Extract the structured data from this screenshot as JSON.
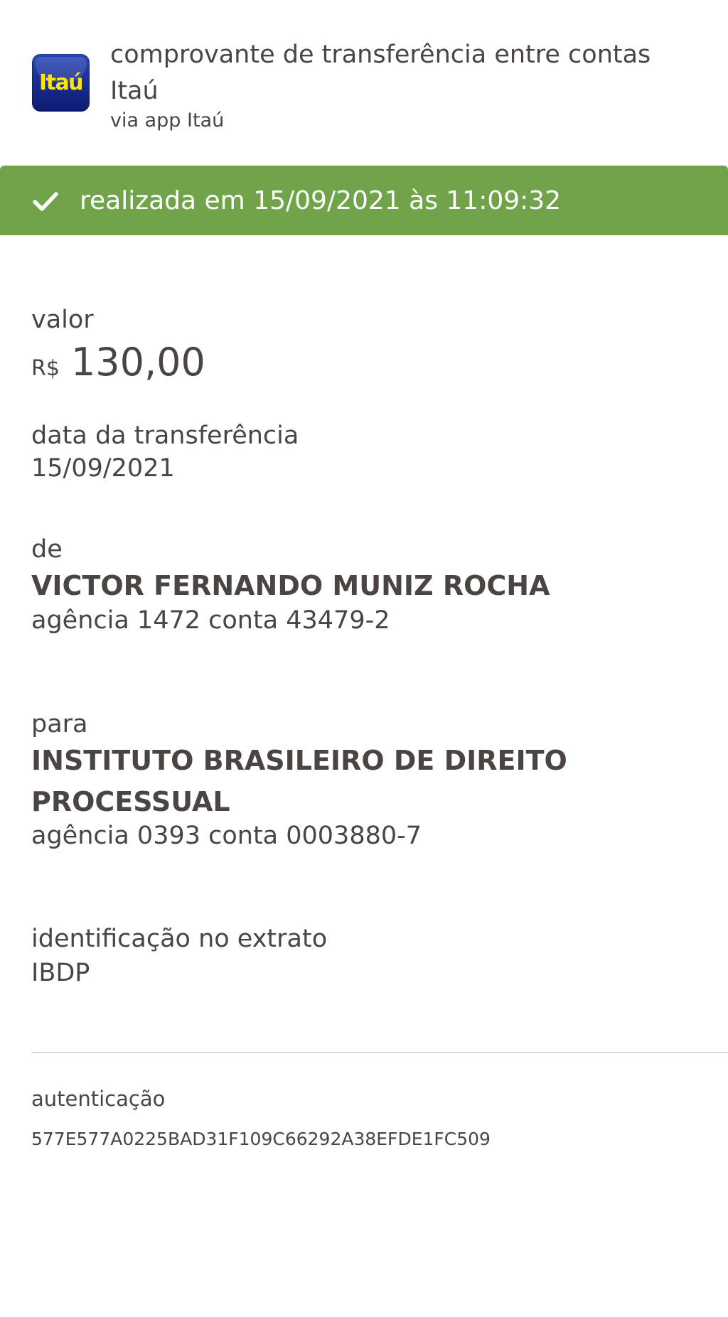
{
  "header": {
    "logo_text": "Itaú",
    "title": "comprovante de transferência entre contas Itaú",
    "subtitle": "via app Itaú"
  },
  "status": {
    "icon": "check-icon",
    "text": "realizada em 15/09/2021 às 11:09:32",
    "color": "#70a34a"
  },
  "valor": {
    "label": "valor",
    "currency": "R$",
    "amount": "130,00"
  },
  "data_transferencia": {
    "label": "data da transferência",
    "value": "15/09/2021"
  },
  "de": {
    "label": "de",
    "name": "VICTOR FERNANDO MUNIZ ROCHA",
    "account": "agência 1472 conta 43479-2"
  },
  "para": {
    "label": "para",
    "name": "INSTITUTO BRASILEIRO DE DIREITO PROCESSUAL",
    "account": "agência 0393 conta 0003880-7"
  },
  "identificacao": {
    "label": "identificação no extrato",
    "value": "IBDP"
  },
  "autenticacao": {
    "label": "autenticação",
    "code": "577E577A0225BAD31F109C66292A38EFDE1FC509"
  }
}
